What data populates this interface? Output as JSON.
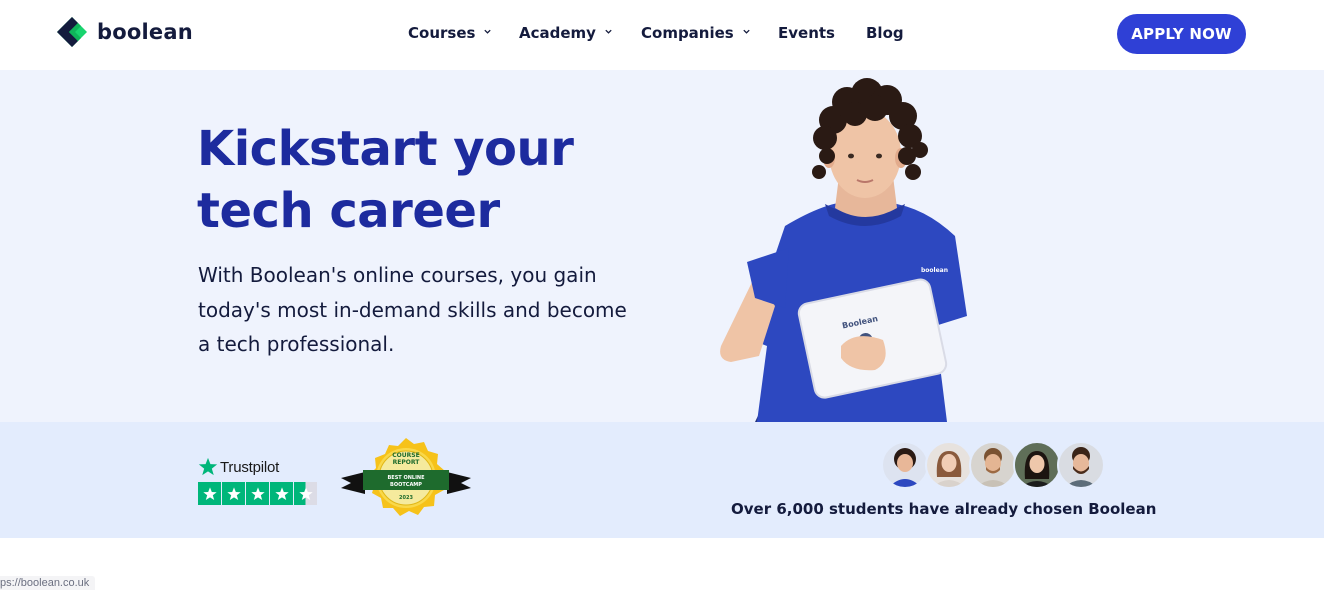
{
  "brand": {
    "name": "boolean"
  },
  "nav": {
    "items": [
      {
        "label": "Courses",
        "has_dropdown": true
      },
      {
        "label": "Academy",
        "has_dropdown": true
      },
      {
        "label": "Companies",
        "has_dropdown": true
      },
      {
        "label": "Events",
        "has_dropdown": false
      },
      {
        "label": "Blog",
        "has_dropdown": false
      }
    ],
    "cta_label": "APPLY NOW"
  },
  "hero": {
    "title_lines": [
      "Kickstart your",
      "tech career"
    ],
    "subtitle_lines": [
      "With Boolean's online courses, you gain",
      "today's most in-demand skills and become",
      "a tech professional."
    ],
    "shirt_logo": "boolean",
    "laptop_logo": "Boolean"
  },
  "proof": {
    "trustpilot": {
      "brand": "Trustpilot",
      "rating_stars": 4.5,
      "max_stars": 5
    },
    "badge": {
      "line1": "COURSE",
      "line2": "REPORT",
      "line3": "BEST ONLINE",
      "line4": "BOOTCAMP",
      "year": "2023"
    },
    "avatars_count": 5,
    "students_text": "Over 6,000 students have already chosen Boolean"
  },
  "status_bar": {
    "url": "ps://boolean.co.uk"
  },
  "colors": {
    "accent": "#2f40d6",
    "headline": "#1d2b9e",
    "hero_bg": "#eff3fd",
    "proof_bg": "#e3ecfd",
    "logo_green": "#18d46e",
    "trustpilot_green": "#00b67a"
  }
}
